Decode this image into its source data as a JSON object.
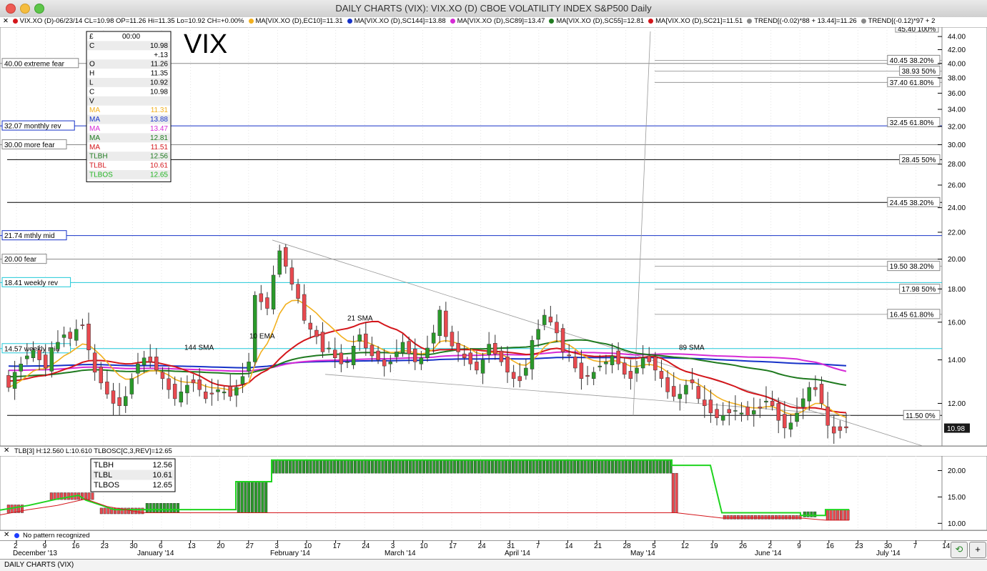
{
  "window": {
    "title": "DAILY CHARTS (VIX): VIX.XO (D) CBOE VOLATILITY INDEX S&P500 Daily",
    "status": "DAILY CHARTS (VIX)"
  },
  "legend": [
    {
      "text": "VIX.XO (D)-06/23/14 CL=10.98 OP=11.26 Hi=11.35 Lo=10.92 CH=+0.00%",
      "color": "#d4161b"
    },
    {
      "text": "MA[VIX.XO (D),EC10]=11.31",
      "color": "#f2b01e"
    },
    {
      "text": "MA[VIX.XO (D),SC144]=13.88",
      "color": "#1632c8"
    },
    {
      "text": "MA[VIX.XO (D),SC89]=13.47",
      "color": "#d62ad6"
    },
    {
      "text": "MA[VIX.XO (D),SC55]=12.81",
      "color": "#1f7a1f"
    },
    {
      "text": "MA[VIX.XO (D),SC21]=11.51",
      "color": "#d4161b"
    },
    {
      "text": "TREND[(-0.02)*88 + 13.44]=11.26",
      "color": "#888888"
    },
    {
      "text": "TREND[(-0.12)*97 + 2",
      "color": "#888888"
    }
  ],
  "sub_legend": "TLB[3] H:12.560 L:10.610 TLBOSC[C,3,REV]=12.65",
  "pattern_text": "No pattern recognized",
  "big_label": "VIX",
  "data_window": {
    "header": [
      "£",
      "00:00"
    ],
    "rows": [
      {
        "k": "C",
        "v": "10.98",
        "color": "#000000"
      },
      {
        "k": "",
        "v": "+.13",
        "color": "#000000"
      },
      {
        "k": "O",
        "v": "11.26",
        "color": "#000000"
      },
      {
        "k": "H",
        "v": "11.35",
        "color": "#000000"
      },
      {
        "k": "L",
        "v": "10.92",
        "color": "#000000"
      },
      {
        "k": "C",
        "v": "10.98",
        "color": "#000000"
      },
      {
        "k": "V",
        "v": "",
        "color": "#000000"
      },
      {
        "k": "MA",
        "v": "11.31",
        "color": "#f2b01e"
      },
      {
        "k": "MA",
        "v": "13.88",
        "color": "#1632c8"
      },
      {
        "k": "MA",
        "v": "13.47",
        "color": "#d62ad6"
      },
      {
        "k": "MA",
        "v": "12.81",
        "color": "#1f7a1f"
      },
      {
        "k": "MA",
        "v": "11.51",
        "color": "#d4161b"
      },
      {
        "k": "TLBH",
        "v": "12.56",
        "color": "#1f7a1f"
      },
      {
        "k": "TLBL",
        "v": "10.61",
        "color": "#d4161b"
      },
      {
        "k": "TLBOS",
        "v": "12.65",
        "color": "#22b422"
      }
    ]
  },
  "sub_window": {
    "rows": [
      {
        "k": "TLBH",
        "v": "12.56"
      },
      {
        "k": "TLBL",
        "v": "10.61"
      },
      {
        "k": "TLBOS",
        "v": "12.65"
      }
    ]
  },
  "chart_data": {
    "type": "candlestick",
    "title": "DAILY CHARTS (VIX): VIX.XO (D) CBOE VOLATILITY INDEX S&P500 Daily",
    "ylim": [
      10.4,
      44.8
    ],
    "y_ticks": [
      12,
      14,
      16,
      18,
      20,
      22,
      24,
      26,
      28,
      30,
      32,
      34,
      36,
      38,
      40,
      42,
      44
    ],
    "x_ticks": [
      "2",
      "9",
      "16",
      "23",
      "30",
      "6",
      "13",
      "20",
      "27",
      "3",
      "10",
      "17",
      "24",
      "3",
      "10",
      "17",
      "24",
      "31",
      "7",
      "14",
      "21",
      "28",
      "5",
      "12",
      "19",
      "26",
      "2",
      "9",
      "16",
      "23",
      "30",
      "7",
      "14"
    ],
    "month_labels": [
      "December '13",
      "January '14",
      "February '14",
      "March '14",
      "April '14",
      "May '14",
      "June '14",
      "July '14"
    ],
    "horizontal_levels": [
      {
        "label": "40.00 extreme fear",
        "value": 40.0,
        "color": "#888888"
      },
      {
        "label": "32.07 monthly rev",
        "value": 32.07,
        "color": "#1632c8"
      },
      {
        "label": "30.00 more fear",
        "value": 30.0,
        "color": "#888888"
      },
      {
        "label": "21.74 mthly mid",
        "value": 21.74,
        "color": "#1632c8"
      },
      {
        "label": "20.00 fear",
        "value": 20.0,
        "color": "#888888"
      },
      {
        "label": "18.41 weekly rev",
        "value": 18.41,
        "color": "#20c8d8"
      },
      {
        "label": "14.57 weekly mid",
        "value": 14.57,
        "color": "#20c8d8"
      }
    ],
    "fib_labels": [
      {
        "label": "40.45 38.20%",
        "value": 40.45
      },
      {
        "label": "38.93 50%",
        "value": 38.93
      },
      {
        "label": "37.40 61.80%",
        "value": 37.4
      },
      {
        "label": "32.45 61.80%",
        "value": 32.45
      },
      {
        "label": "28.45 50%",
        "value": 28.45
      },
      {
        "label": "24.45 38.20%",
        "value": 24.45
      },
      {
        "label": "19.50 38.20%",
        "value": 19.5
      },
      {
        "label": "17.98 50%",
        "value": 17.98
      },
      {
        "label": "16.45 61.80%",
        "value": 16.45
      },
      {
        "label": "11.50 0%",
        "value": 11.5
      },
      {
        "label": "45.40 100%",
        "value": 45.4
      }
    ],
    "last_price_label": "10.98",
    "annotations": [
      "10 EMA",
      "21 SMA",
      "144 SMA",
      "89 SMA"
    ],
    "sub_chart": {
      "ylim": [
        9.5,
        22.5
      ],
      "y_ticks": [
        "10.00",
        "15.00",
        "20.00"
      ]
    }
  },
  "colors": {
    "up": "#2a9a2a",
    "down": "#e8494f",
    "ema10": "#f2b01e",
    "sma21": "#d4161b",
    "sma55": "#1f7a1f",
    "sma89": "#d62ad6",
    "sma144": "#1632c8"
  }
}
